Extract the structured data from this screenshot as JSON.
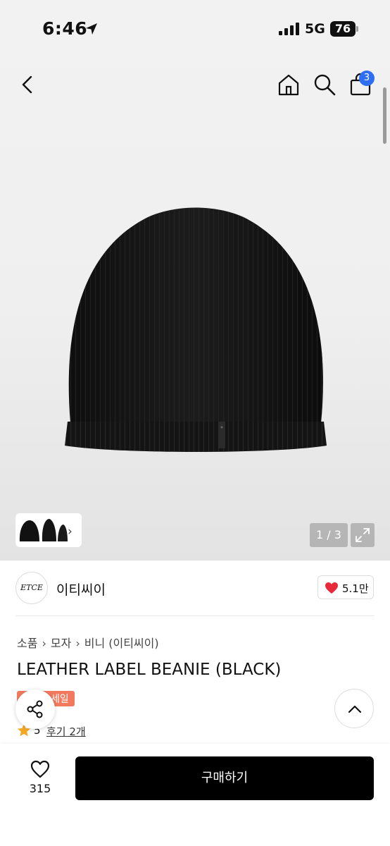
{
  "status_bar": {
    "time": "6:46",
    "network": "5G",
    "battery": "76"
  },
  "nav": {
    "cart_count": "3"
  },
  "gallery": {
    "counter": "1 / 3"
  },
  "brand": {
    "logo_text": "ETCE",
    "name": "이티씨이",
    "likes": "5.1만"
  },
  "product": {
    "breadcrumbs": [
      "소품",
      "모자",
      "비니 (이티씨이)"
    ],
    "title": "LEATHER LABEL BEANIE (BLACK)",
    "sale_badge": "세일",
    "rating": "5",
    "reviews": "후기 2개"
  },
  "bottom": {
    "wish_count": "315",
    "buy_label": "구매하기"
  },
  "colors": {
    "accent_blue": "#2e6ff2",
    "like_red": "#e8293a",
    "sale": "#f2795e",
    "star": "#f5a623"
  },
  "icons": [
    "location-arrow-icon",
    "back-icon",
    "home-icon",
    "search-icon",
    "shopping-bag-icon",
    "chevron-right-icon",
    "expand-icon",
    "heart-icon",
    "share-icon",
    "chevron-up-icon",
    "star-icon"
  ]
}
